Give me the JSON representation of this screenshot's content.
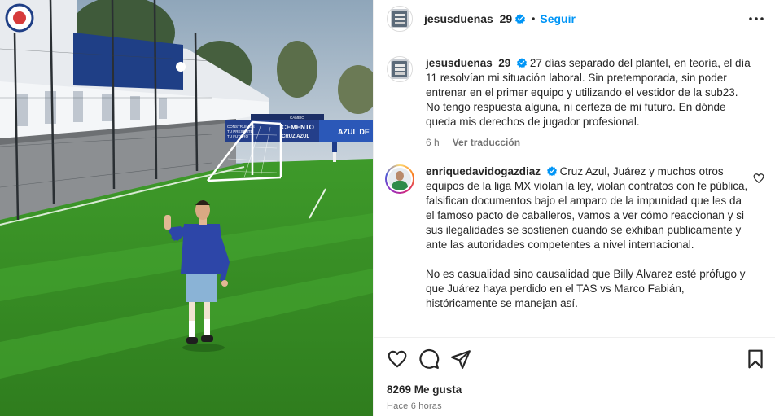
{
  "post": {
    "author": "jesusduenas_29",
    "follow_label": "Seguir",
    "separator": "•",
    "likes_label": "8269 Me gusta",
    "time_ago": "Hace 6 horas"
  },
  "caption": {
    "username": "jesusduenas_29",
    "text": "27 días separado del plantel, en teoría, el día 11 resolvían mi situación laboral. Sin pretemporada, sin poder entrenar en el primer equipo y utilizando el vestidor de la sub23. No tengo respuesta alguna, ni certeza de mi futuro. En dónde queda mis derechos de jugador profesional.",
    "age": "6 h",
    "translate_label": "Ver traducción"
  },
  "comment": {
    "username": "enriquedavidogazdiaz",
    "paragraph1": "Cruz Azul, Juárez y muchos otros equipos de la liga MX violan la ley, violan contratos con fe pública, falsifican documentos bajo el amparo de la impunidad que les da el famoso pacto de caballeros, vamos a ver cómo reaccionan y si sus ilegalidades se sostienen cuando se exhiban públicamente y ante las autoridades competentes a nivel internacional.",
    "paragraph2": "No es casualidad sino causalidad que Billy Alvarez esté prófugo y que Juárez haya perdido en el TAS vs Marco Fabián, históricamente se manejan así."
  },
  "photo_signage": {
    "banner1_line1": "CONSTRUIMOS",
    "banner1_line2": "TU PRESENTE",
    "banner1_line3": "TU FUTURO",
    "banner2_line1": "CEMENTO",
    "banner2_line2": "CRUZ AZUL",
    "banner3": "AZUL DE",
    "banner_top": "CAMBIO"
  },
  "icons": {
    "verified": "verified-badge-icon",
    "more": "more-options-icon",
    "like": "heart-icon",
    "comment": "comment-icon",
    "share": "paper-plane-icon",
    "save": "bookmark-icon",
    "comment_like": "small-heart-icon"
  },
  "colors": {
    "link_blue": "#0095f6",
    "verified_blue": "#0095f6",
    "text": "#262626",
    "secondary_text": "#737373",
    "divider": "#efefef"
  }
}
